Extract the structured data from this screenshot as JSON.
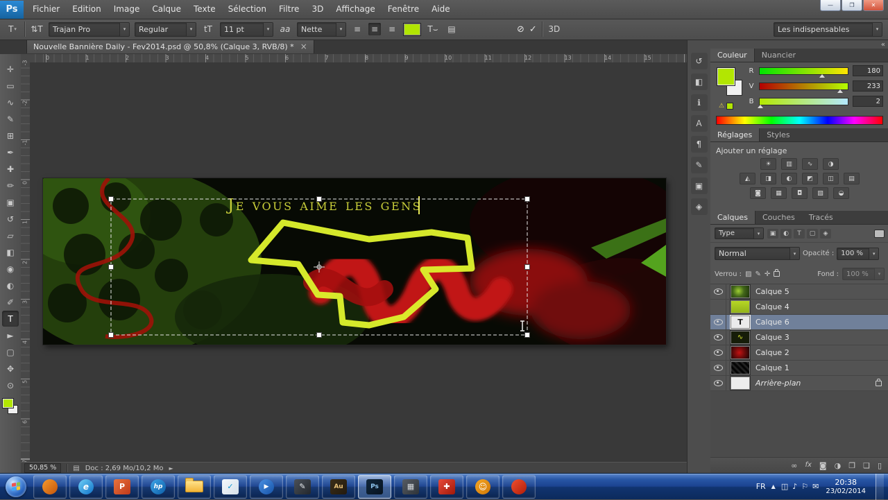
{
  "window": {
    "logo_text": "Ps",
    "controls": {
      "minimize": "—",
      "restore": "❐",
      "close": "✕"
    }
  },
  "menu": {
    "items": [
      "Fichier",
      "Edition",
      "Image",
      "Calque",
      "Texte",
      "Sélection",
      "Filtre",
      "3D",
      "Affichage",
      "Fenêtre",
      "Aide"
    ]
  },
  "options_bar": {
    "tool_preset_glyph": "T",
    "orientation_glyph": "⇅T",
    "font_family": "Trajan Pro",
    "font_style": "Regular",
    "size_glyph": "tT",
    "font_size": "11 pt",
    "aa_glyph": "aa",
    "anti_aliasing": "Nette",
    "align_glyph": "≡",
    "color_swatch": "#b2e602",
    "warp_glyph": "T⌣",
    "panels_glyph": "▤",
    "cancel_glyph": "⊘",
    "commit_glyph": "✓",
    "threed_label": "3D",
    "workspace": "Les indispensables"
  },
  "ui": {
    "dropdown_glyph": "▾",
    "collapse_glyph": "«",
    "flyout_glyph": "►"
  },
  "tab": {
    "title": "Nouvelle Bannière Daily - Fev2014.psd @ 50,8% (Calque 3, RVB/8) *",
    "close_glyph": "×"
  },
  "rulers": {
    "h_labels": [
      "0",
      "1",
      "2",
      "3",
      "4",
      "5",
      "6",
      "7",
      "8",
      "9",
      "10",
      "11",
      "12",
      "13",
      "14",
      "15"
    ],
    "v_labels": [
      "-3",
      "-2",
      "-1",
      "0",
      "1",
      "2",
      "3",
      "4",
      "5",
      "6",
      "7"
    ]
  },
  "tools": [
    {
      "name": "move-tool",
      "glyph": "✛"
    },
    {
      "name": "marquee-tool",
      "glyph": "▭"
    },
    {
      "name": "lasso-tool",
      "glyph": "∿"
    },
    {
      "name": "quick-selection-tool",
      "glyph": "✎"
    },
    {
      "name": "crop-tool",
      "glyph": "⊞"
    },
    {
      "name": "eyedropper-tool",
      "glyph": "✒"
    },
    {
      "name": "healing-brush-tool",
      "glyph": "✚"
    },
    {
      "name": "brush-tool",
      "glyph": "✏"
    },
    {
      "name": "clone-stamp-tool",
      "glyph": "▣"
    },
    {
      "name": "history-brush-tool",
      "glyph": "↺"
    },
    {
      "name": "eraser-tool",
      "glyph": "▱"
    },
    {
      "name": "gradient-tool",
      "glyph": "◧"
    },
    {
      "name": "blur-tool",
      "glyph": "◉"
    },
    {
      "name": "dodge-tool",
      "glyph": "◐"
    },
    {
      "name": "pen-tool",
      "glyph": "✐"
    },
    {
      "name": "type-tool",
      "glyph": "T",
      "active": true
    },
    {
      "name": "path-selection-tool",
      "glyph": "►"
    },
    {
      "name": "shape-tool",
      "glyph": "▢"
    },
    {
      "name": "hand-tool",
      "glyph": "✥"
    },
    {
      "name": "zoom-tool",
      "glyph": "⊙"
    }
  ],
  "canvas_text": {
    "value": "Je vous aime les gens"
  },
  "dock_icons": [
    {
      "name": "history-panel-icon",
      "glyph": "↺"
    },
    {
      "name": "properties-panel-icon",
      "glyph": "◧"
    },
    {
      "name": "info-panel-icon",
      "glyph": "ℹ"
    },
    {
      "name": "character-panel-icon",
      "glyph": "A"
    },
    {
      "name": "paragraph-panel-icon",
      "glyph": "¶"
    },
    {
      "name": "brush-panel-icon",
      "glyph": "✎"
    },
    {
      "name": "clone-source-panel-icon",
      "glyph": "▣"
    },
    {
      "name": "navigator-panel-icon",
      "glyph": "◈"
    }
  ],
  "color_panel": {
    "tabs": [
      "Couleur",
      "Nuancier"
    ],
    "warning_glyph": "⚠",
    "channels": [
      {
        "label": "R",
        "value": "180",
        "pct": 71
      },
      {
        "label": "V",
        "value": "233",
        "pct": 91
      },
      {
        "label": "B",
        "value": "2",
        "pct": 1
      }
    ]
  },
  "adjustments_panel": {
    "tabs": [
      "Réglages",
      "Styles"
    ],
    "heading": "Ajouter un réglage",
    "rows": [
      [
        {
          "name": "brightness-contrast-icon",
          "glyph": "☀"
        },
        {
          "name": "levels-icon",
          "glyph": "▥"
        },
        {
          "name": "curves-icon",
          "glyph": "∿"
        },
        {
          "name": "exposure-icon",
          "glyph": "◑"
        }
      ],
      [
        {
          "name": "vibrance-icon",
          "glyph": "◭"
        },
        {
          "name": "hue-saturation-icon",
          "glyph": "◨"
        },
        {
          "name": "color-balance-icon",
          "glyph": "◐"
        },
        {
          "name": "black-white-icon",
          "glyph": "◩"
        },
        {
          "name": "photo-filter-icon",
          "glyph": "◫"
        },
        {
          "name": "channel-mixer-icon",
          "glyph": "▤"
        }
      ],
      [
        {
          "name": "invert-icon",
          "glyph": "◙"
        },
        {
          "name": "posterize-icon",
          "glyph": "▦"
        },
        {
          "name": "threshold-icon",
          "glyph": "◘"
        },
        {
          "name": "gradient-map-icon",
          "glyph": "▧"
        },
        {
          "name": "selective-color-icon",
          "glyph": "◒"
        }
      ]
    ]
  },
  "layers_panel": {
    "tabs": [
      "Calques",
      "Couches",
      "Tracés"
    ],
    "filter": {
      "combo": "Type",
      "icons": [
        {
          "name": "filter-pixel-icon",
          "glyph": "▣"
        },
        {
          "name": "filter-adjustment-icon",
          "glyph": "◐"
        },
        {
          "name": "filter-type-icon",
          "glyph": "T"
        },
        {
          "name": "filter-shape-icon",
          "glyph": "▢"
        },
        {
          "name": "filter-smart-icon",
          "glyph": "◈"
        }
      ]
    },
    "blend_mode": "Normal",
    "opacity_label": "Opacité :",
    "opacity_value": "100 %",
    "lock_label": "Verrou :",
    "lock_icons": [
      {
        "name": "lock-transparent-icon",
        "glyph": "▨"
      },
      {
        "name": "lock-pixels-icon",
        "glyph": "✎"
      },
      {
        "name": "lock-position-icon",
        "glyph": "✛"
      },
      {
        "name": "lock-all-icon",
        "glyph": "lock"
      }
    ],
    "fill_label": "Fond :",
    "fill_value": "100 %",
    "layers": [
      {
        "name": "Calque 5",
        "visible": true,
        "selected": false,
        "thumb": "green",
        "locked": false
      },
      {
        "name": "Calque 4",
        "visible": false,
        "selected": false,
        "thumb": "lime",
        "locked": false
      },
      {
        "name": "Calque 6",
        "visible": true,
        "selected": true,
        "thumb": "text",
        "locked": false
      },
      {
        "name": "Calque 3",
        "visible": true,
        "selected": false,
        "thumb": "squiggle",
        "locked": false
      },
      {
        "name": "Calque 2",
        "visible": true,
        "selected": false,
        "thumb": "red",
        "locked": false
      },
      {
        "name": "Calque 1",
        "visible": true,
        "selected": false,
        "thumb": "dark",
        "locked": false
      },
      {
        "name": "Arrière-plan",
        "visible": true,
        "selected": false,
        "thumb": "white",
        "locked": true,
        "italic": true
      }
    ],
    "bottom_icons": [
      {
        "name": "link-layers-icon",
        "glyph": "∞"
      },
      {
        "name": "layer-effects-icon",
        "glyph": "fx"
      },
      {
        "name": "add-layer-mask-icon",
        "glyph": "◙"
      },
      {
        "name": "new-adjustment-layer-icon",
        "glyph": "◑"
      },
      {
        "name": "new-group-icon",
        "glyph": "❐"
      },
      {
        "name": "new-layer-icon",
        "glyph": "❏"
      },
      {
        "name": "delete-layer-icon",
        "glyph": "▯"
      }
    ]
  },
  "status_bar": {
    "zoom": "50,85 %",
    "icon_glyph": "▤",
    "doc_info": "Doc : 2,69 Mo/10,2 Mo"
  },
  "taskbar": {
    "icons": [
      {
        "name": "firefox",
        "shape": "circle",
        "bg1": "#f79b2e",
        "bg2": "#c2540a",
        "glyph": "",
        "fg": "#fff"
      },
      {
        "name": "internet-explorer",
        "shape": "circle",
        "bg1": "#6fd0f7",
        "bg2": "#1173c8",
        "glyph": "e",
        "fg": "#ffffff"
      },
      {
        "name": "powerpoint",
        "shape": "tile",
        "bg1": "#e8733c",
        "bg2": "#c0391b",
        "glyph": "P",
        "fg": "#ffffff"
      },
      {
        "name": "hp",
        "shape": "circle",
        "bg1": "#3fa6e8",
        "bg2": "#0c5ea8",
        "glyph": "hp",
        "fg": "#ffffff",
        "small": true
      },
      {
        "name": "explorer-folder",
        "shape": "folder"
      },
      {
        "name": "sync-app",
        "shape": "tile",
        "bg1": "#f4f8fc",
        "bg2": "#d6e0ea",
        "glyph": "✓",
        "fg": "#0d94d2"
      },
      {
        "name": "media-player",
        "shape": "circle",
        "bg1": "#4a90e2",
        "bg2": "#1653a8",
        "glyph": "▶",
        "fg": "#ffffff",
        "small": true
      },
      {
        "name": "pen-app",
        "shape": "tile",
        "bg1": "#4a5058",
        "bg2": "#23272c",
        "glyph": "✎",
        "fg": "#e6e9ed"
      },
      {
        "name": "audition",
        "shape": "tile",
        "bg1": "#3a2d18",
        "bg2": "#241b0e",
        "glyph": "Au",
        "fg": "#e8c27a",
        "small": true
      },
      {
        "name": "photoshop",
        "shape": "tile",
        "bg1": "#10273c",
        "bg2": "#081420",
        "glyph": "Ps",
        "fg": "#8fc6f0",
        "small": true,
        "active": true
      },
      {
        "name": "video-editor",
        "shape": "tile",
        "bg1": "#565c64",
        "bg2": "#2e3338",
        "glyph": "▦",
        "fg": "#d6dade"
      },
      {
        "name": "security",
        "shape": "tile",
        "bg1": "#e84a3a",
        "bg2": "#a01808",
        "glyph": "✚",
        "fg": "#ffffff"
      },
      {
        "name": "messenger",
        "shape": "circle",
        "bg1": "#f5a623",
        "bg2": "#d07808",
        "glyph": "☺",
        "fg": "#ffffff"
      },
      {
        "name": "browser",
        "shape": "circle",
        "bg1": "#f05030",
        "bg2": "#b01c08",
        "glyph": "",
        "fg": "#ffffff"
      }
    ],
    "tray": {
      "lang": "FR",
      "overflow_glyph": "▲",
      "icons": [
        {
          "name": "tray-display-icon",
          "glyph": "◫"
        },
        {
          "name": "tray-volume-icon",
          "glyph": "♪"
        },
        {
          "name": "tray-network-icon",
          "glyph": "⚐"
        },
        {
          "name": "tray-message-icon",
          "glyph": "✉"
        }
      ],
      "time": "20:38",
      "date": "23/02/2014"
    }
  }
}
